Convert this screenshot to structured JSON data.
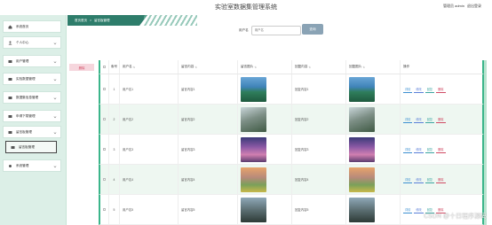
{
  "app": {
    "title": "实验室数据集管理系统"
  },
  "header": {
    "admin_label": "管理员 admin",
    "logout_label": "退出登录"
  },
  "sidebar": {
    "items": [
      {
        "label": "系统首页",
        "icon": "home-icon"
      },
      {
        "label": "个人中心",
        "icon": "user-icon"
      },
      {
        "label": "用户管理",
        "icon": "users-icon"
      },
      {
        "label": "实验数据管理",
        "icon": "data-icon"
      },
      {
        "label": "数据集信息管理",
        "icon": "database-icon"
      },
      {
        "label": "申请下载管理",
        "icon": "download-icon"
      },
      {
        "label": "留言板管理",
        "icon": "message-icon"
      },
      {
        "label": "留言板管理",
        "icon": "message-icon"
      },
      {
        "label": "系统管理",
        "icon": "settings-icon"
      }
    ]
  },
  "breadcrumb": {
    "home": "首页首页",
    "separator": ">",
    "current": "留言板管理"
  },
  "search": {
    "label": "用户名",
    "placeholder": "用户名",
    "button": "查询"
  },
  "toolbar": {
    "delete_label": "删除"
  },
  "table": {
    "columns": [
      "索号",
      "用户名",
      "留言内容",
      "留言图片",
      "回复内容",
      "回复图片",
      "操作"
    ],
    "rows": [
      {
        "index": "1",
        "user": "用户名1",
        "content": "留言内容1",
        "reply": "回复内容1"
      },
      {
        "index": "2",
        "user": "用户名2",
        "content": "留言内容2",
        "reply": "回复内容2"
      },
      {
        "index": "3",
        "user": "用户名3",
        "content": "留言内容3",
        "reply": "回复内容3"
      },
      {
        "index": "4",
        "user": "用户名4",
        "content": "留言内容4",
        "reply": "回复内容4"
      },
      {
        "index": "5",
        "user": "用户名5",
        "content": "留言内容5",
        "reply": "回复内容5"
      }
    ],
    "actions": [
      "详情",
      "修改",
      "回复",
      "删除"
    ]
  },
  "watermark": "CSDN @十日程序源码",
  "colors": {
    "accent": "#2e7d6b",
    "sidebar_bg": "#dcefe7",
    "row_alt": "#eef7f1",
    "delete": "#d04b64",
    "search_btn": "#8aa3b5"
  }
}
